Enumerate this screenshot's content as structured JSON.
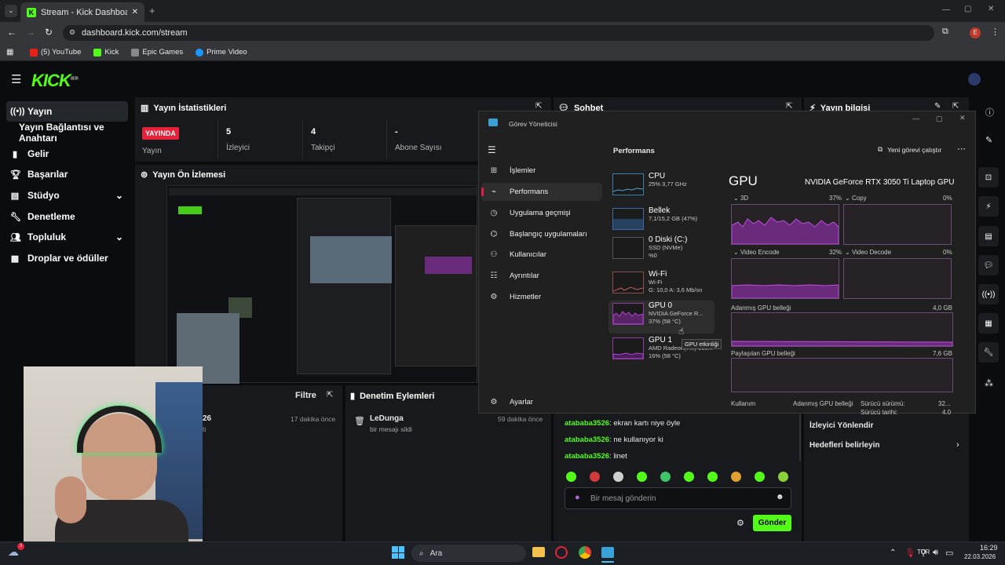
{
  "browser": {
    "tab_title": "Stream - Kick Dashboard",
    "url": "dashboard.kick.com/stream",
    "profile_initial": "E",
    "bookmarks": [
      "(5) YouTube",
      "Kick",
      "Epic Games",
      "Prime Video"
    ]
  },
  "kick": {
    "logo": "KICK",
    "logo_sup": "BETA",
    "sidebar": [
      "Yayın",
      "Yayın Bağlantısı ve Anahtarı",
      "Gelir",
      "Başarılar",
      "Stüdyo",
      "Denetleme",
      "Topluluk",
      "Droplar ve ödüller"
    ],
    "stats": {
      "title": "Yayın İstatistikleri",
      "live_badge": "YAYINDA",
      "live_label": "Yayın",
      "viewers_num": "5",
      "viewers_label": "İzleyici",
      "followers_num": "4",
      "followers_label": "Takipçi",
      "subs_num": "-",
      "subs_label": "Abone Sayısı"
    },
    "chat_title": "Sohbet",
    "info_title": "Yayın bilgisi",
    "preview_title": "Yayın Ön İzlemesi",
    "filter_label": "Filtre",
    "activity_item": {
      "partial_name": "26",
      "partial_sub": "ti",
      "time": "17 dakika önce"
    },
    "moderation": {
      "title": "Denetim Eylemleri",
      "user": "LeDunga",
      "action": "bir mesajı sildi",
      "time": "59 dakika önce"
    },
    "chat_messages": [
      {
        "user": "atababa3526",
        "text": ": ekran kartı niye öyle"
      },
      {
        "user": "atababa3526",
        "text": ": ne kullanıyor ki"
      },
      {
        "user": "atababa3526",
        "text": ": linet"
      }
    ],
    "chat_placeholder": "Bir mesaj gönderin",
    "send_label": "Gönder",
    "right_items": [
      "İzleyici Yönlendir",
      "Hedefleri belirleyin"
    ]
  },
  "taskmanager": {
    "title": "Görev Yöneticisi",
    "section": "Performans",
    "run_task": "Yeni görevi çalıştır",
    "nav": [
      "İşlemler",
      "Performans",
      "Uygulama geçmişi",
      "Başlangıç uygulamaları",
      "Kullanıcılar",
      "Ayrıntılar",
      "Hizmetler"
    ],
    "settings": "Ayarlar",
    "devices": [
      {
        "name": "CPU",
        "l1": "25% 3,77 GHz",
        "l2": ""
      },
      {
        "name": "Bellek",
        "l1": "7,1/15,2 GB (47%)",
        "l2": ""
      },
      {
        "name": "0 Diski (C:)",
        "l1": "SSD (NVMe)",
        "l2": "%0"
      },
      {
        "name": "Wi-Fi",
        "l1": "Wi-Fi",
        "l2": "G: 10,0 A: 3,6 Mb/sn"
      },
      {
        "name": "GPU 0",
        "l1": "NVIDIA GeForce R...",
        "l2": "37% (58 °C)"
      },
      {
        "name": "GPU 1",
        "l1": "AMD Radeon(TM) 660...",
        "l2": "16% (58 °C)"
      }
    ],
    "tooltip": "GPU etkinliği",
    "gpu_title": "GPU",
    "gpu_model": "NVIDIA GeForce RTX 3050 Ti Laptop GPU",
    "graphs": [
      {
        "label": "3D",
        "value": "37%"
      },
      {
        "label": "Copy",
        "value": "0%"
      },
      {
        "label": "Video Encode",
        "value": "32%"
      },
      {
        "label": "Video Decode",
        "value": "0%"
      }
    ],
    "dedicated_label": "Adanmış GPU belleği",
    "dedicated_value": "4,0 GB",
    "shared_label": "Paylaşılan GPU belleği",
    "shared_value": "7,6 GB",
    "footer": [
      "Kullanım",
      "Adanmış GPU belleği",
      "Sürücü sürümü:",
      "32...",
      "Sürücü tarihi:",
      "4.0"
    ]
  },
  "taskbar": {
    "search": "Ara",
    "language": "TUR",
    "time": "16:29",
    "date": "22.03.2026",
    "notif_count": "3"
  },
  "colors": {
    "kick_green": "#53fc18",
    "live_red": "#e6223a",
    "gpu_purple": "#8e3ba2"
  }
}
